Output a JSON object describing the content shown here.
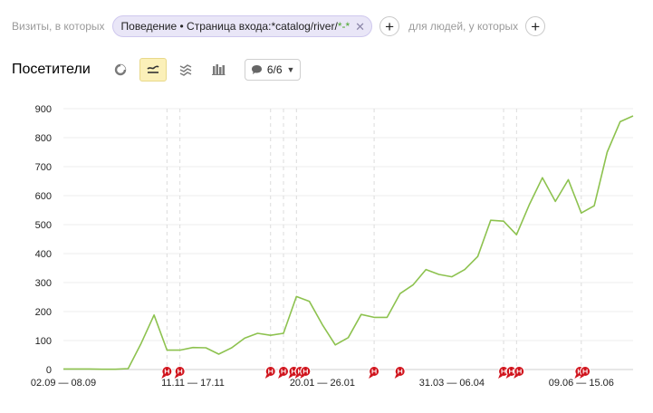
{
  "filters": {
    "visits_label": "Визиты, в которых",
    "chip_main": "Поведение • Страница входа: ",
    "chip_value": "*catalog/river/",
    "chip_accent": "*-*",
    "people_label": "для людей, у которых"
  },
  "toolbar": {
    "title": "Посетители",
    "notes_count": "6/6"
  },
  "icons": {
    "pie": "pie-chart-icon",
    "line": "line-chart-icon",
    "area": "area-chart-icon",
    "bar": "bar-chart-icon",
    "comment": "comment-icon"
  },
  "colors": {
    "line": "#8dc24f",
    "marker": "#d0121b",
    "active": "#fbf0b9"
  },
  "chart_data": {
    "type": "line",
    "ylim": [
      0,
      900
    ],
    "yticks": [
      0,
      100,
      200,
      300,
      400,
      500,
      600,
      700,
      800,
      900
    ],
    "x_labels": [
      "02.09 — 08.09",
      "11.11 — 17.11",
      "20.01 — 26.01",
      "31.03 — 06.04",
      "09.06 — 15.06"
    ],
    "x_label_index": [
      0,
      10,
      20,
      30,
      40
    ],
    "series": [
      {
        "values": [
          2,
          2,
          2,
          1,
          1,
          3,
          90,
          188,
          67,
          67,
          76,
          75,
          53,
          75,
          108,
          125,
          118,
          125,
          252,
          235,
          155,
          85,
          110,
          190,
          180,
          180,
          262,
          292,
          345,
          328,
          320,
          345,
          390,
          515,
          512,
          465,
          570,
          662,
          580,
          655,
          540,
          565,
          750,
          855,
          875
        ]
      }
    ],
    "annotation_positions": [
      8,
      9,
      16,
      17,
      17.8,
      18.3,
      18.7,
      24,
      26,
      34,
      34.6,
      35.2,
      39.9,
      40.3
    ],
    "dashed_lines": [
      8,
      9,
      16,
      17,
      18,
      24,
      34,
      35,
      40
    ]
  }
}
